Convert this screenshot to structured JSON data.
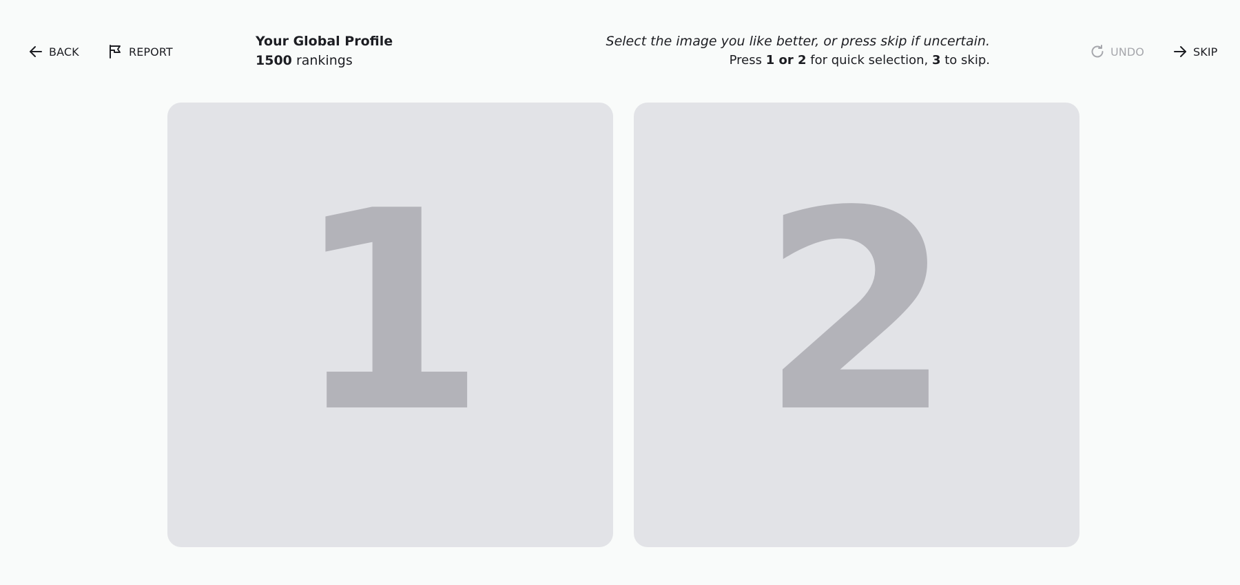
{
  "header": {
    "back_label": "BACK",
    "report_label": "REPORT",
    "undo_label": "UNDO",
    "skip_label": "SKIP",
    "profile_title": "Your Global Profile",
    "rankings_count": "1500",
    "rankings_label": "rankings",
    "instruction_main": "Select the image you like better, or press skip if uncertain.",
    "instruction_press": "Press",
    "instruction_keys": "1 or 2",
    "instruction_for": "for quick selection,",
    "instruction_skip_key": "3",
    "instruction_to_skip": "to skip."
  },
  "cards": [
    {
      "label": "1"
    },
    {
      "label": "2"
    }
  ],
  "colors": {
    "background": "#f9fbfa",
    "card": "#e2e3e7",
    "placeholder_digit": "#b3b3b9",
    "text": "#1c1d22",
    "disabled_text": "#a6a7ac"
  },
  "icons": {
    "back": "arrow-left-icon",
    "report": "flag-icon",
    "undo": "refresh-icon",
    "skip": "arrow-right-icon"
  }
}
